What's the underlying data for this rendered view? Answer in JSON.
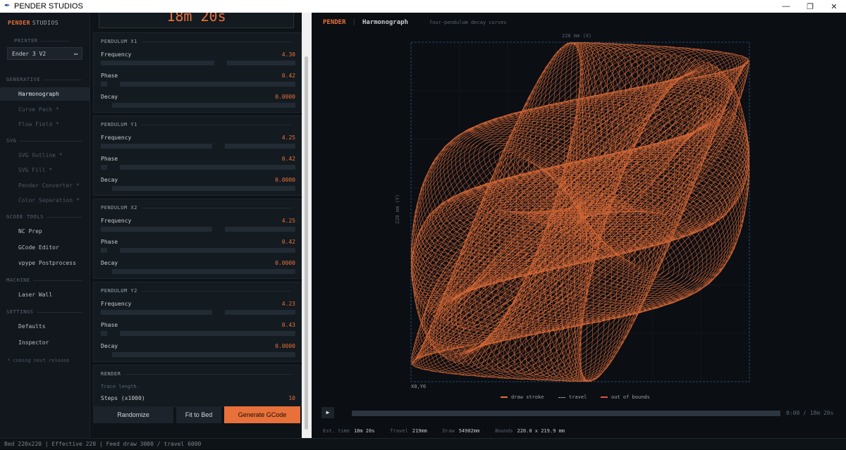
{
  "window": {
    "title": "PENDER STUDIOS",
    "minimize": "—",
    "restore": "❐",
    "close": "✕"
  },
  "sidebar": {
    "brand_primary": "PENDER",
    "brand_secondary": "STUDIOS",
    "printer_section": "PRINTER",
    "printer_value": "Ender 3 V2",
    "sections": {
      "generative": "GENERATIVE",
      "svg": "SVG",
      "gcode": "GCODE TOOLS",
      "machine": "MACHINE",
      "settings": "SETTINGS"
    },
    "items": {
      "harmonograph": "Harmonograph",
      "curve_pack": "Curve Pack *",
      "flow_field": "Flow Field *",
      "svg_outline": "SVG Outline *",
      "svg_fill": "SVG Fill *",
      "pender_converter": "Pender Converter *",
      "color_separation": "Color Separation *",
      "nc_prep": "NC Prep",
      "gcode_editor": "GCode Editor",
      "vpype": "vpype Postprocess",
      "laser_wall": "Laser Wall",
      "defaults": "Defaults",
      "inspector": "Inspector"
    },
    "footnote": "* coming next release"
  },
  "panel": {
    "est_time_big": "18m 20s",
    "pendulums": [
      {
        "title": "PENDULUM X1",
        "frequency_label": "Frequency",
        "frequency": "4.30",
        "frequency_fraction": 0.62,
        "phase_label": "Phase",
        "phase": "0.42",
        "phase_fraction": 0.07,
        "decay_label": "Decay",
        "decay": "0.0000",
        "decay_fraction": 0.0
      },
      {
        "title": "PENDULUM Y1",
        "frequency_label": "Frequency",
        "frequency": "4.25",
        "frequency_fraction": 0.61,
        "phase_label": "Phase",
        "phase": "0.42",
        "phase_fraction": 0.07,
        "decay_label": "Decay",
        "decay": "0.0000",
        "decay_fraction": 0.0
      },
      {
        "title": "PENDULUM X2",
        "frequency_label": "Frequency",
        "frequency": "4.25",
        "frequency_fraction": 0.61,
        "phase_label": "Phase",
        "phase": "0.42",
        "phase_fraction": 0.07,
        "decay_label": "Decay",
        "decay": "0.0000",
        "decay_fraction": 0.0
      },
      {
        "title": "PENDULUM Y2",
        "frequency_label": "Frequency",
        "frequency": "4.23",
        "frequency_fraction": 0.61,
        "phase_label": "Phase",
        "phase": "0.43",
        "phase_fraction": 0.07,
        "decay_label": "Decay",
        "decay": "0.0000",
        "decay_fraction": 0.0
      }
    ],
    "render": {
      "title": "RENDER",
      "subtitle": "Trace length.",
      "steps_label": "Steps (x1000)",
      "steps": "10"
    },
    "buttons": {
      "randomize": "Randomize",
      "fit": "Fit to Bed",
      "generate": "Generate GCode"
    }
  },
  "canvas": {
    "brand": "PENDER",
    "separator": "|",
    "title": "Harmonograph",
    "subtitle": "four-pendulum decay curves",
    "x_axis_label": "220 mm  (X)",
    "y_axis_label": "220 mm  (Y)",
    "origin_label": "X0,Y0",
    "legend": {
      "draw": "draw stroke",
      "travel": "travel",
      "oob": "out of bounds"
    },
    "play": "▶",
    "time_readout": "0:00 / 18m 20s",
    "stats": {
      "est_label": "Est. time",
      "est": "18m 20s",
      "travel_label": "Travel",
      "travel": "219mm",
      "draw_label": "Draw",
      "draw": "54902mm",
      "bounds_label": "Bounds",
      "bounds": "220.0 x 219.9 mm"
    }
  },
  "status": {
    "text": "Bed 220x220  |  Effective 220  |  Feed draw 3000 / travel 6000"
  },
  "colors": {
    "accent": "#e8703a",
    "background": "#0a0d12",
    "panel": "#131a20",
    "oob": "#e05050"
  }
}
